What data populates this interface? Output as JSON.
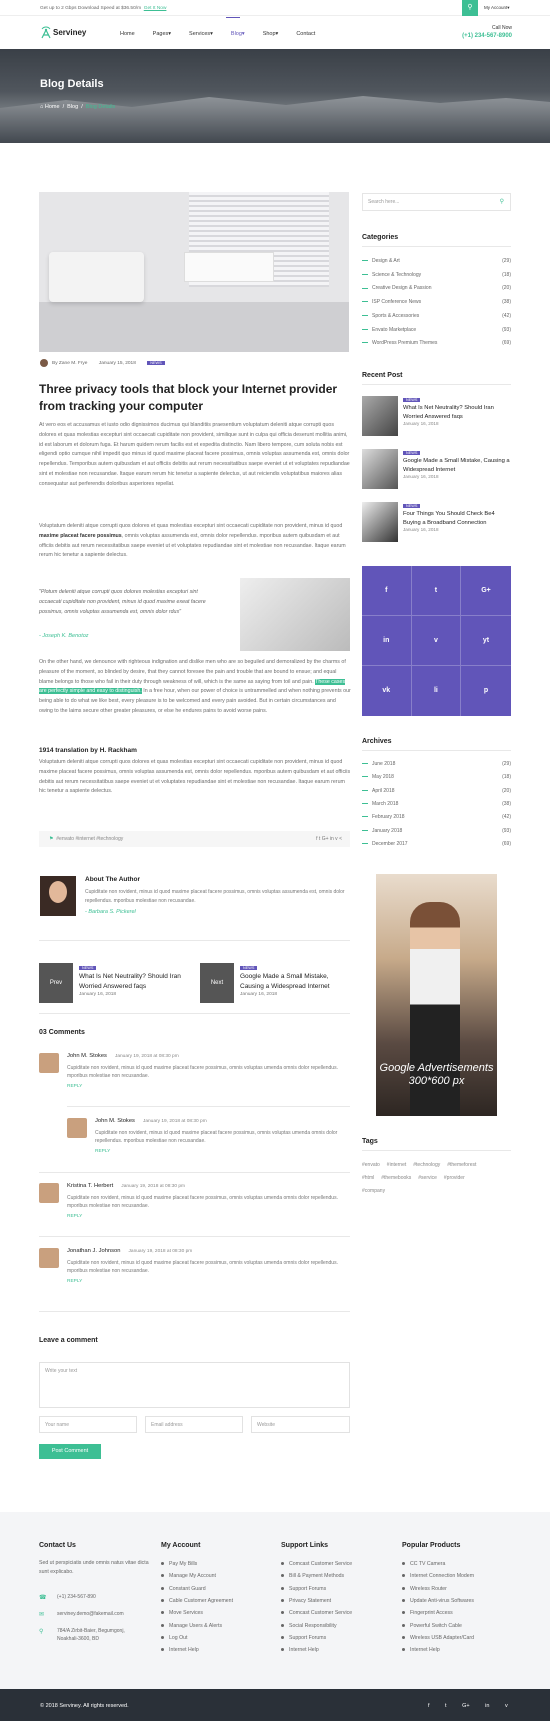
{
  "colors": {
    "accent": "#3dbf94",
    "brand": "#6155b9",
    "footer_bg": "#f4f5f7",
    "bottom_bg": "#2a3038"
  },
  "topbar": {
    "promo": "Get up to 2 Gbps Download Speed at $36.50/m",
    "promo_link": "Get It Now",
    "search_icon": "search-icon",
    "account": "My Account"
  },
  "header": {
    "logo": "Serviney",
    "nav": [
      "Home",
      "Pages",
      "Services",
      "Blog",
      "Shop",
      "Contact"
    ],
    "call_label": "Call Now",
    "phone": "(+1) 234-567-8900"
  },
  "hero": {
    "title": "Blog Details",
    "crumbs": [
      "Home",
      "Blog",
      "Blog Details"
    ]
  },
  "post": {
    "author": "By Zane M. Frye",
    "date": "January 15, 2018",
    "badge": "NEWS",
    "title": "Three privacy tools that block your Internet provider from tracking your computer",
    "p1": "At vero eos et accusamus et iusto odio dignissimos ducimus qui blanditiis praesentium voluptatum deleniti atque corrupti quos dolores et quas molestias excepturi sint occaecati cupiditate non provident, similique sunt in culpa qui officia deserunt mollitia animi, id est laborum et dolorum fuga. Et harum quidem rerum facilis est et expedita distinctio. Nam libero tempore, cum soluta nobis est eligendi optio cumque nihil impedit quo minus id quod maxime placeat facere possimus, omnis voluptas assumenda est, omnis dolor repellendus. Temporibus autem quibusdam et aut officiis debitis aut rerum necessitatibus saepe eveniet ut et voluptates repudiandae sint et molestiae non recusandae. Itaque earum rerum hic tenetur a sapiente delectus, ut aut reiciendis voluptatibus maiores alias consequatur aut perferendis doloribus asperiores repellat.",
    "p2a": "Voluptatum deleniti atque corrupti quos dolores et quas molestias excepturi sint occaecati cupiditate non provident, minus id quod ",
    "p2b": "maxime placeat facere possimus",
    "p2c": ", omnis voluptas assumenda est, omnis dolor repellendus. mporibus autem quibusdam et aut officiis debitis aut rerum necessitatibus saepe eveniet ut et voluptates repudiandae sint et molestiae non recusandae. Itaque earum rerum hic tenetur a sapiente delectus.",
    "quote": "\"Plotum deleniti atque corrupti quos dolores molestias excepturi sint occaecati cupiditate non provident, minus id quod maxime exeat facere possimus, omnis voluptas assumenda est, omnis dolor rdus\"",
    "quote_author": "- Joseph K. Benotoz",
    "p3a": "On the other hand, we denounce with righteous indignation and dislike men who are so beguiled and demoralized by the charms of pleasure of the moment, so blinded by desire, that they cannot foresee the pain and trouble that are bound to ensue; and equal blame belongs to those who fail in their duty through weakness of will, which is the same as saying from toil and pain. ",
    "p3hl": "These cases are perfectly simple and easy to distinguish.",
    "p3b": " In a free hour, when our power of choice is untrammelled and when nothing prevents our being able to do what we like best, every pleasure is to be welcomed and every pain avoided. But in certain circumstances and owing to the laims secure other greater pleasures, or else he endures pains to avoid worse pains.",
    "h4": "1914 translation by H. Rackham",
    "p4": "Voluptatum deleniti atque corrupti quos dolores et quas molestias excepturi sint occaecati cupiditate non provident, minus id quod maxime placeat facere possimus, omnis voluptas assumenda est, omnis dolor repellendus. mporibus autem quibusdam et aut officiis debitis aut rerum necessitatibus saepe eveniet ut et voluptates repudiandae sint et molestiae non recusandae. Itaque earum rerum hic tenetur a sapiente delectus.",
    "tags": "#envato   #internet   #technology",
    "share": "f  t  G+  in  v  <"
  },
  "author_box": {
    "heading": "About The Author",
    "text": "Cupiditate non rovident, minus id quod maxime placeat facere possimus, omnis voluptas assumenda est, omnis dolor repellendus. mporibus molestiae non recusandae.",
    "signature": "- Barbara S. Pickerel"
  },
  "postnav": {
    "prev": {
      "label": "Prev",
      "badge": "NEWS",
      "title": "What Is Net Neutrality? Should Iran Worried Answered faqs",
      "date": "January 16, 2018"
    },
    "next": {
      "label": "Next",
      "badge": "NEWS",
      "title": "Google Made a Small Mistake, Causing a Widespread Internet",
      "date": "January 16, 2018"
    }
  },
  "comments": {
    "heading": "03 Comments",
    "items": [
      {
        "name": "John M. Stokes",
        "date": "January 19, 2018 at 08:30 pm",
        "text": "Cupiditate non rovident, minus id quod maxime placeat facere possimus, omnis voluptas umenda omnis dolor repellendus. mporibus molestiae non recusandae.",
        "reply": "REPLY"
      },
      {
        "name": "John M. Stokes",
        "date": "January 19, 2018 at 08:30 pm",
        "text": "Cupiditate non rovident, minus id quod maxime placeat facere possimus, omnis voluptas umenda omnis dolor repellendus. mporibus molestiae non recusandae.",
        "reply": "REPLY"
      },
      {
        "name": "Kristina T. Herbert",
        "date": "January 19, 2018 at 08:30 pm",
        "text": "Cupiditate non rovident, minus id quod maxime placeat facere possimus, omnis voluptas umenda omnis dolor repellendus. mporibus molestiae non recusandae.",
        "reply": "REPLY"
      },
      {
        "name": "Jonathan J. Johnson",
        "date": "January 19, 2018 at 08:30 pm",
        "text": "Cupiditate non rovident, minus id quod maxime placeat facere possimus, omnis voluptas umenda omnis dolor repellendus. mporibus molestiae non recusandae.",
        "reply": "REPLY"
      }
    ]
  },
  "form": {
    "heading": "Leave a comment",
    "text_ph": "Write your text",
    "name_ph": "Your name",
    "email_ph": "Email address",
    "web_ph": "Website",
    "button": "Post Comment"
  },
  "sidebar": {
    "search_ph": "Search here...",
    "categories_h": "Categories",
    "categories": [
      [
        "Design & Art",
        "(29)"
      ],
      [
        "Science & Technology",
        "(18)"
      ],
      [
        "Creative Design & Passion",
        "(20)"
      ],
      [
        "ISP Conference News",
        "(38)"
      ],
      [
        "Sports & Accessories",
        "(42)"
      ],
      [
        "Envato Marketplace",
        "(93)"
      ],
      [
        "WordPress Premium Themes",
        "(69)"
      ]
    ],
    "recent_h": "Recent Post",
    "recent": [
      {
        "badge": "NEWS",
        "title": "What Is Net Neutrality? Should Iran Worried Answered faqs",
        "date": "January 16, 2018"
      },
      {
        "badge": "NEWS",
        "title": "Google Made a Small Mistake, Causing a Widespread Internet",
        "date": "January 16, 2018"
      },
      {
        "badge": "NEWS",
        "title": "Four Things You Should Check Be4 Buying a Broadband Connection",
        "date": "January 16, 2018"
      }
    ],
    "social": [
      "f",
      "t",
      "G+",
      "in",
      "v",
      "yt",
      "vk",
      "li",
      "p"
    ],
    "archives_h": "Archives",
    "archives": [
      [
        "June 2018",
        "(29)"
      ],
      [
        "May 2018",
        "(18)"
      ],
      [
        "April 2018",
        "(20)"
      ],
      [
        "March 2018",
        "(38)"
      ],
      [
        "February 2018",
        "(42)"
      ],
      [
        "January 2018",
        "(93)"
      ],
      [
        "December 2017",
        "(69)"
      ]
    ],
    "ad_text": "Google Advertisements 300*600 px",
    "tags_h": "Tags",
    "tags": [
      [
        "#envato",
        "#internet",
        "#technology",
        "#themeforest"
      ],
      [
        "#html",
        "#themebooks",
        "#service",
        "#provider"
      ],
      [
        "#company"
      ]
    ]
  },
  "footer": {
    "contact_h": "Contact Us",
    "contact_text": "Sed ut perspiciatis unde omnis natus vitae dicta sunt explicabo.",
    "phone": "(+1) 234-567-890",
    "email": "serviney.demo@fakemail.com",
    "address": "784/A Zirbit-Baier, Begumgonj, Noakhali-3600, BD",
    "cols": [
      {
        "h": "My Account",
        "items": [
          "Pay My Bills",
          "Manage My Account",
          "Constant Guard",
          "Cable Customer Agreement",
          "Move Services",
          "Manage Users & Alerts",
          "Log Out",
          "Internet Help"
        ]
      },
      {
        "h": "Support Links",
        "items": [
          "Comcast Customer Service",
          "Bill & Payment Methods",
          "Support Forums",
          "Privacy Statement",
          "Comcast Customer Service",
          "Social Responsibility",
          "Support Forums",
          "Internet Help"
        ]
      },
      {
        "h": "Popular Products",
        "items": [
          "CC TV Camera",
          "Internet Connection Modem",
          "Wireless Router",
          "Update Anti-virus Softwares",
          "Fingerprint Access",
          "Powerful Switch Cable",
          "Wireless USB Adapter/Card",
          "Internet Help"
        ]
      }
    ],
    "copyright": "© 2018 Serviney. All rights reserved.",
    "social": "f t G+ in v"
  }
}
